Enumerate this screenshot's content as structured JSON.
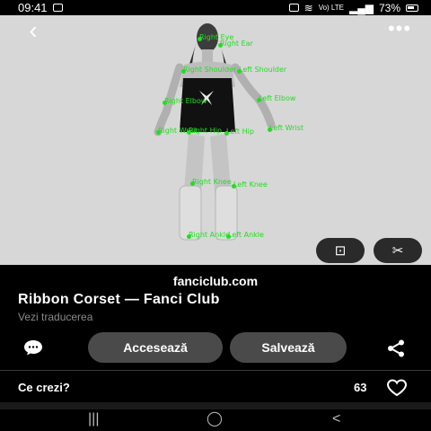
{
  "status_bar": {
    "time": "09:41",
    "network": "Vo) LTE",
    "battery": "73%"
  },
  "photo": {
    "keypoint_labels": [
      "Right Eye",
      "Right Ear",
      "Right Shoulder",
      "Left Shoulder",
      "Right Elbow",
      "Left Elbow",
      "Left Wrist",
      "Right Wrist",
      "Right Hip",
      "Left Hip",
      "Right Knee",
      "Left Knee",
      "Right Ankle",
      "Left Ankle"
    ],
    "keypoint_color": "#22dd22",
    "lens_icon": "lens-icon",
    "scissors_icon": "scissors-icon"
  },
  "pin": {
    "domain": "fanciclub.com",
    "title": "Ribbon Corset — Fanci Club",
    "translate_label": "Vezi traducerea"
  },
  "actions": {
    "visit_label": "Accesează",
    "save_label": "Salvează"
  },
  "comments": {
    "prompt": "Ce crezi?",
    "likes": "63"
  },
  "nav": {
    "recents": "|||",
    "home": "◯",
    "back": "<"
  }
}
